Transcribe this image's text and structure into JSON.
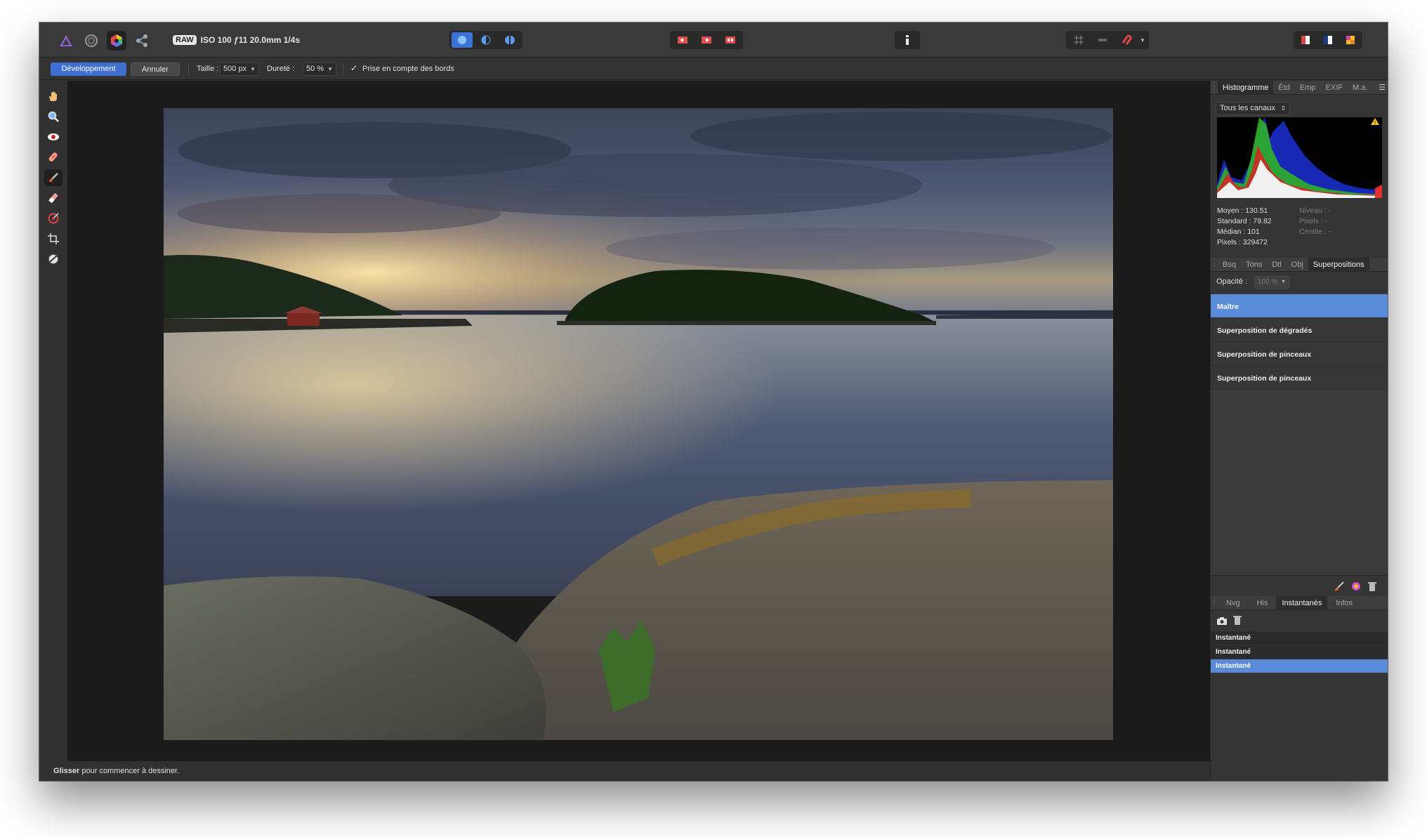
{
  "topbar": {
    "raw_badge": "RAW",
    "exif": "ISO 100 ƒ11 20.0mm 1/4s"
  },
  "context": {
    "develop": "Développement",
    "cancel": "Annuler",
    "size_label": "Taille :",
    "size_value": "500 px",
    "hardness_label": "Dureté :",
    "hardness_value": "50 %",
    "edges_check": "✓",
    "edges_label": "Prise en compte des bords"
  },
  "panel": {
    "top_tabs": [
      "Histogramme",
      "Étd",
      "Emp",
      "EXIF",
      "M.a."
    ],
    "channel": "Tous les canaux",
    "stats_left": [
      "Moyen : 130.51",
      "Standard : 79.82",
      "Médian : 101",
      "Pixels : 329472"
    ],
    "stats_right": [
      "Niveau : -",
      "Pixels : -",
      "Centile : -"
    ],
    "mid_tabs": [
      "Bsq",
      "Tons",
      "Dtl",
      "Obj",
      "Superpositions"
    ],
    "opacity_label": "Opacité :",
    "opacity_value": "100 %",
    "overlays": [
      "Maître",
      "Superposition de dégradés",
      "Superposition de pinceaux",
      "Superposition de pinceaux"
    ],
    "bottom_tabs": [
      "Nvg",
      "His",
      "Instantanés",
      "Infos"
    ],
    "snapshots": [
      "Instantané",
      "Instantané",
      "Instantané"
    ]
  },
  "status": {
    "bold": "Glisser",
    "text": " pour commencer à dessiner."
  }
}
